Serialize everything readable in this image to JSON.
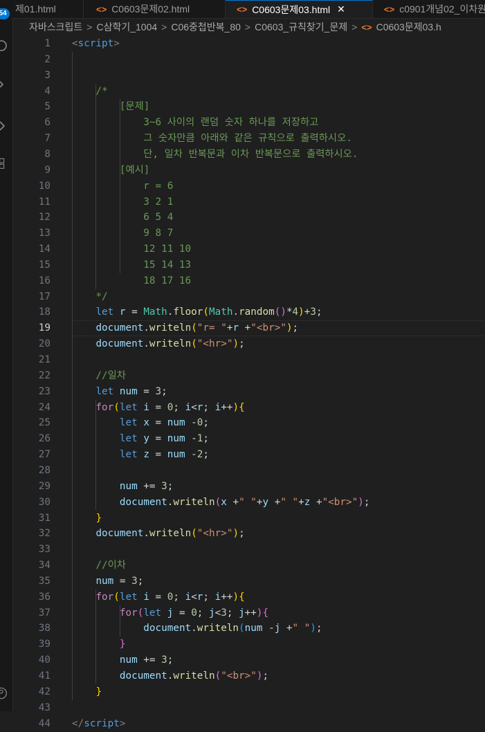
{
  "activity_bar": {
    "badge": "54"
  },
  "tabs": [
    {
      "label": "제01.html",
      "icon": "",
      "active": false
    },
    {
      "label": "C0603문제02.html",
      "icon": "<>",
      "active": false
    },
    {
      "label": "C0603문제03.html",
      "icon": "<>",
      "active": true
    },
    {
      "label": "c0901개념02_이차원",
      "icon": "<>",
      "active": false
    }
  ],
  "breadcrumb": [
    "자바스크립트",
    "C삼학기_1004",
    "C06중첩반복_80",
    "C0603_규칙찾기_문제",
    "C0603문제03.h"
  ],
  "editor": {
    "current_line": 19,
    "lines": [
      [
        [
          "<",
          "t-tag"
        ],
        [
          "script",
          "t-tagname"
        ],
        [
          ">",
          "t-tag"
        ]
      ],
      [],
      [],
      [
        [
          "    /*",
          "t-cmt"
        ]
      ],
      [
        [
          "        [문제]",
          "t-cmt"
        ]
      ],
      [
        [
          "            3~6 사이의 랜덤 숫자 하나를 저장하고",
          "t-cmt"
        ]
      ],
      [
        [
          "            그 숫자만큼 아래와 같은 규칙으로 출력하시오.",
          "t-cmt"
        ]
      ],
      [
        [
          "            단, 일차 반복문과 이차 반복문으로 출력하시오.",
          "t-cmt"
        ]
      ],
      [
        [
          "        [예시]",
          "t-cmt"
        ]
      ],
      [
        [
          "            r = 6",
          "t-cmt"
        ]
      ],
      [
        [
          "            3 2 1",
          "t-cmt"
        ]
      ],
      [
        [
          "            6 5 4",
          "t-cmt"
        ]
      ],
      [
        [
          "            9 8 7",
          "t-cmt"
        ]
      ],
      [
        [
          "            12 11 10",
          "t-cmt"
        ]
      ],
      [
        [
          "            15 14 13",
          "t-cmt"
        ]
      ],
      [
        [
          "            18 17 16",
          "t-cmt"
        ]
      ],
      [
        [
          "    */",
          "t-cmt"
        ]
      ],
      [
        [
          "    ",
          "t-op"
        ],
        [
          "let",
          "t-kw"
        ],
        [
          " ",
          "t-op"
        ],
        [
          "r",
          "t-var"
        ],
        [
          " = ",
          "t-op"
        ],
        [
          "Math",
          "t-obj"
        ],
        [
          ".",
          "t-op"
        ],
        [
          "floor",
          "t-fn"
        ],
        [
          "(",
          "t-p1"
        ],
        [
          "Math",
          "t-obj"
        ],
        [
          ".",
          "t-op"
        ],
        [
          "random",
          "t-fn"
        ],
        [
          "()",
          "t-p2"
        ],
        [
          "*",
          "t-op"
        ],
        [
          "4",
          "t-num"
        ],
        [
          ")",
          "t-p1"
        ],
        [
          "+",
          "t-op"
        ],
        [
          "3",
          "t-num"
        ],
        [
          ";",
          "t-op"
        ]
      ],
      [
        [
          "    ",
          "t-op"
        ],
        [
          "document",
          "t-var"
        ],
        [
          ".",
          "t-op"
        ],
        [
          "writeln",
          "t-fn"
        ],
        [
          "(",
          "t-p1"
        ],
        [
          "\"r= \"",
          "t-str"
        ],
        [
          "+",
          "t-op"
        ],
        [
          "r",
          "t-var"
        ],
        [
          " +",
          "t-op"
        ],
        [
          "\"<br>\"",
          "t-str"
        ],
        [
          ")",
          "t-p1"
        ],
        [
          ";",
          "t-op"
        ]
      ],
      [
        [
          "    ",
          "t-op"
        ],
        [
          "document",
          "t-var"
        ],
        [
          ".",
          "t-op"
        ],
        [
          "writeln",
          "t-fn"
        ],
        [
          "(",
          "t-p1"
        ],
        [
          "\"<hr>\"",
          "t-str"
        ],
        [
          ")",
          "t-p1"
        ],
        [
          ";",
          "t-op"
        ]
      ],
      [],
      [
        [
          "    //일차",
          "t-cmt"
        ]
      ],
      [
        [
          "    ",
          "t-op"
        ],
        [
          "let",
          "t-kw"
        ],
        [
          " ",
          "t-op"
        ],
        [
          "num",
          "t-var"
        ],
        [
          " = ",
          "t-op"
        ],
        [
          "3",
          "t-num"
        ],
        [
          ";",
          "t-op"
        ]
      ],
      [
        [
          "    ",
          "t-op"
        ],
        [
          "for",
          "t-ctl"
        ],
        [
          "(",
          "t-p1"
        ],
        [
          "let",
          "t-kw"
        ],
        [
          " ",
          "t-op"
        ],
        [
          "i",
          "t-var"
        ],
        [
          " = ",
          "t-op"
        ],
        [
          "0",
          "t-num"
        ],
        [
          "; ",
          "t-op"
        ],
        [
          "i",
          "t-var"
        ],
        [
          "<",
          "t-op"
        ],
        [
          "r",
          "t-var"
        ],
        [
          "; ",
          "t-op"
        ],
        [
          "i",
          "t-var"
        ],
        [
          "++",
          "t-op"
        ],
        [
          ")",
          "t-p1"
        ],
        [
          "{",
          "t-p1"
        ]
      ],
      [
        [
          "        ",
          "t-op"
        ],
        [
          "let",
          "t-kw"
        ],
        [
          " ",
          "t-op"
        ],
        [
          "x",
          "t-var"
        ],
        [
          " = ",
          "t-op"
        ],
        [
          "num",
          "t-var"
        ],
        [
          " -",
          "t-op"
        ],
        [
          "0",
          "t-num"
        ],
        [
          ";",
          "t-op"
        ]
      ],
      [
        [
          "        ",
          "t-op"
        ],
        [
          "let",
          "t-kw"
        ],
        [
          " ",
          "t-op"
        ],
        [
          "y",
          "t-var"
        ],
        [
          " = ",
          "t-op"
        ],
        [
          "num",
          "t-var"
        ],
        [
          " -",
          "t-op"
        ],
        [
          "1",
          "t-num"
        ],
        [
          ";",
          "t-op"
        ]
      ],
      [
        [
          "        ",
          "t-op"
        ],
        [
          "let",
          "t-kw"
        ],
        [
          " ",
          "t-op"
        ],
        [
          "z",
          "t-var"
        ],
        [
          " = ",
          "t-op"
        ],
        [
          "num",
          "t-var"
        ],
        [
          " -",
          "t-op"
        ],
        [
          "2",
          "t-num"
        ],
        [
          ";",
          "t-op"
        ]
      ],
      [],
      [
        [
          "        ",
          "t-op"
        ],
        [
          "num",
          "t-var"
        ],
        [
          " += ",
          "t-op"
        ],
        [
          "3",
          "t-num"
        ],
        [
          ";",
          "t-op"
        ]
      ],
      [
        [
          "        ",
          "t-op"
        ],
        [
          "document",
          "t-var"
        ],
        [
          ".",
          "t-op"
        ],
        [
          "writeln",
          "t-fn"
        ],
        [
          "(",
          "t-p2"
        ],
        [
          "x",
          "t-var"
        ],
        [
          " +",
          "t-op"
        ],
        [
          "\" \"",
          "t-str"
        ],
        [
          "+",
          "t-op"
        ],
        [
          "y",
          "t-var"
        ],
        [
          " +",
          "t-op"
        ],
        [
          "\" \"",
          "t-str"
        ],
        [
          "+",
          "t-op"
        ],
        [
          "z",
          "t-var"
        ],
        [
          " +",
          "t-op"
        ],
        [
          "\"<br>\"",
          "t-str"
        ],
        [
          ")",
          "t-p2"
        ],
        [
          ";",
          "t-op"
        ]
      ],
      [
        [
          "    ",
          "t-op"
        ],
        [
          "}",
          "t-p1"
        ]
      ],
      [
        [
          "    ",
          "t-op"
        ],
        [
          "document",
          "t-var"
        ],
        [
          ".",
          "t-op"
        ],
        [
          "writeln",
          "t-fn"
        ],
        [
          "(",
          "t-p1"
        ],
        [
          "\"<hr>\"",
          "t-str"
        ],
        [
          ")",
          "t-p1"
        ],
        [
          ";",
          "t-op"
        ]
      ],
      [],
      [
        [
          "    //이차",
          "t-cmt"
        ]
      ],
      [
        [
          "    ",
          "t-op"
        ],
        [
          "num",
          "t-var"
        ],
        [
          " = ",
          "t-op"
        ],
        [
          "3",
          "t-num"
        ],
        [
          ";",
          "t-op"
        ]
      ],
      [
        [
          "    ",
          "t-op"
        ],
        [
          "for",
          "t-ctl"
        ],
        [
          "(",
          "t-p1"
        ],
        [
          "let",
          "t-kw"
        ],
        [
          " ",
          "t-op"
        ],
        [
          "i",
          "t-var"
        ],
        [
          " = ",
          "t-op"
        ],
        [
          "0",
          "t-num"
        ],
        [
          "; ",
          "t-op"
        ],
        [
          "i",
          "t-var"
        ],
        [
          "<",
          "t-op"
        ],
        [
          "r",
          "t-var"
        ],
        [
          "; ",
          "t-op"
        ],
        [
          "i",
          "t-var"
        ],
        [
          "++",
          "t-op"
        ],
        [
          ")",
          "t-p1"
        ],
        [
          "{",
          "t-p1"
        ]
      ],
      [
        [
          "        ",
          "t-op"
        ],
        [
          "for",
          "t-ctl"
        ],
        [
          "(",
          "t-p2"
        ],
        [
          "let",
          "t-kw"
        ],
        [
          " ",
          "t-op"
        ],
        [
          "j",
          "t-var"
        ],
        [
          " = ",
          "t-op"
        ],
        [
          "0",
          "t-num"
        ],
        [
          "; ",
          "t-op"
        ],
        [
          "j",
          "t-var"
        ],
        [
          "<",
          "t-op"
        ],
        [
          "3",
          "t-num"
        ],
        [
          "; ",
          "t-op"
        ],
        [
          "j",
          "t-var"
        ],
        [
          "++",
          "t-op"
        ],
        [
          ")",
          "t-p2"
        ],
        [
          "{",
          "t-p2"
        ]
      ],
      [
        [
          "            ",
          "t-op"
        ],
        [
          "document",
          "t-var"
        ],
        [
          ".",
          "t-op"
        ],
        [
          "writeln",
          "t-fn"
        ],
        [
          "(",
          "t-p3"
        ],
        [
          "num",
          "t-var"
        ],
        [
          " -",
          "t-op"
        ],
        [
          "j",
          "t-var"
        ],
        [
          " +",
          "t-op"
        ],
        [
          "\" \"",
          "t-str"
        ],
        [
          ")",
          "t-p3"
        ],
        [
          ";",
          "t-op"
        ]
      ],
      [
        [
          "        ",
          "t-op"
        ],
        [
          "}",
          "t-p2"
        ]
      ],
      [
        [
          "        ",
          "t-op"
        ],
        [
          "num",
          "t-var"
        ],
        [
          " += ",
          "t-op"
        ],
        [
          "3",
          "t-num"
        ],
        [
          ";",
          "t-op"
        ]
      ],
      [
        [
          "        ",
          "t-op"
        ],
        [
          "document",
          "t-var"
        ],
        [
          ".",
          "t-op"
        ],
        [
          "writeln",
          "t-fn"
        ],
        [
          "(",
          "t-p2"
        ],
        [
          "\"<br>\"",
          "t-str"
        ],
        [
          ")",
          "t-p2"
        ],
        [
          ";",
          "t-op"
        ]
      ],
      [
        [
          "    ",
          "t-op"
        ],
        [
          "}",
          "t-p1"
        ]
      ],
      [],
      [
        [
          "</",
          "t-tag"
        ],
        [
          "script",
          "t-tagname"
        ],
        [
          ">",
          "t-tag"
        ]
      ]
    ]
  }
}
